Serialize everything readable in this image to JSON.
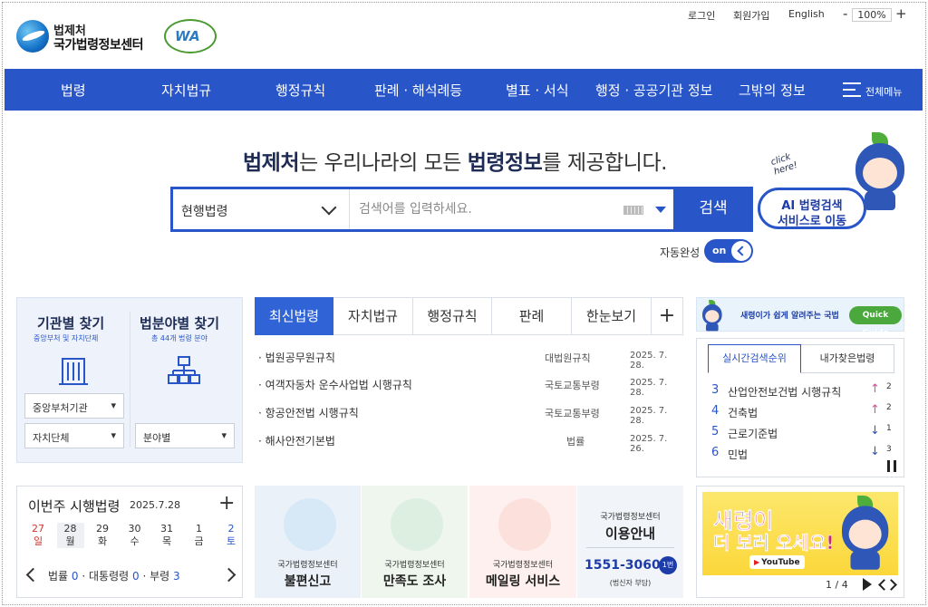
{
  "header": {
    "logo_small": "법제처",
    "logo_big": "국가법령정보센터",
    "wa_mark": "WA",
    "util_links": [
      "로그인",
      "회원가입",
      "English"
    ],
    "zoom": {
      "minus": "-",
      "value": "100%",
      "plus": "+"
    }
  },
  "nav": {
    "items": [
      "법령",
      "자치법규",
      "행정규칙",
      "판례 · 해석례등",
      "별표 · 서식",
      "행정 · 공공기관 정보",
      "그밖의 정보"
    ],
    "all_menu": "전체메뉴"
  },
  "hero": {
    "b1": "법제처",
    "t1": "는 우리나라의 모든 ",
    "b2": "법령정보",
    "t2": "를 제공합니다."
  },
  "search": {
    "scope": "현행법령",
    "placeholder": "검색어를 입력하세요.",
    "button": "검색",
    "autocomplete_label": "자동완성",
    "autocomplete_state": "on"
  },
  "ai_promo": {
    "click": "click\nhere!",
    "line1": "AI 법령검색",
    "line2": "서비스로 이동"
  },
  "find": {
    "org_title": "기관별 찾기",
    "org_sub": "중앙부처 및 자치단체",
    "field_title": "법분야별 찾기",
    "field_sub": "총 44개 법령 분야",
    "sel_central": "중앙부처기관",
    "sel_local": "자치단체",
    "sel_field": "분야별"
  },
  "laws": {
    "tabs": [
      "최신법령",
      "자치법규",
      "행정규칙",
      "판례",
      "한눈보기"
    ],
    "more": "+",
    "items": [
      {
        "name": "· 법원공무원규칙",
        "type": "대법원규칙",
        "date": "2025. 7. 28."
      },
      {
        "name": "· 여객자동차 운수사업법 시행규칙",
        "type": "국토교통부령",
        "date": "2025. 7. 28."
      },
      {
        "name": "· 항공안전법 시행규칙",
        "type": "국토교통부령",
        "date": "2025. 7. 28."
      },
      {
        "name": "· 해사안전기본법",
        "type": "법률",
        "date": "2025. 7. 26."
      }
    ]
  },
  "quick_guide": {
    "text": "새령이가 쉽게 알려주는 국법",
    "button": "Quick Guide"
  },
  "ranking": {
    "tabs": [
      "실시간검색순위",
      "내가찾은법령"
    ],
    "items": [
      {
        "rank": "3",
        "name": "산업안전보건법 시행규칙",
        "dir": "↑",
        "change": "2",
        "color": "#e0479b"
      },
      {
        "rank": "4",
        "name": "건축법",
        "dir": "↑",
        "change": "2",
        "color": "#e0479b"
      },
      {
        "rank": "5",
        "name": "근로기준법",
        "dir": "↓",
        "change": "1",
        "color": "#2855c8"
      },
      {
        "rank": "6",
        "name": "민법",
        "dir": "↓",
        "change": "3",
        "color": "#2855c8"
      }
    ]
  },
  "week": {
    "title": "이번주 시행법령",
    "date": "2025.7.28",
    "plus": "+",
    "days": [
      {
        "num": "27",
        "dow": "일",
        "kind": "sun"
      },
      {
        "num": "28",
        "dow": "월",
        "kind": "today"
      },
      {
        "num": "29",
        "dow": "화",
        "kind": ""
      },
      {
        "num": "30",
        "dow": "수",
        "kind": ""
      },
      {
        "num": "31",
        "dow": "목",
        "kind": ""
      },
      {
        "num": "1",
        "dow": "금",
        "kind": ""
      },
      {
        "num": "2",
        "dow": "토",
        "kind": "sat"
      }
    ],
    "law_label": "법률",
    "law_count": "0",
    "decree_label": "· 대통령령",
    "decree_count": "0",
    "ordinance_label": "· 부령",
    "ordinance_count": "3"
  },
  "cards": [
    {
      "small": "국가법령정보센터",
      "big": "불편신고",
      "bg": "#eaf1f9",
      "circle": "#d7e8f6"
    },
    {
      "small": "국가법령정보센터",
      "big": "만족도 조사",
      "bg": "#eef6ee",
      "circle": "#dcefe0"
    },
    {
      "small": "국가법령정보센터",
      "big": "메일링 서비스",
      "bg": "#fdf0ee",
      "circle": "#fbe0dc"
    }
  ],
  "info": {
    "small": "국가법령정보센터",
    "big": "이용안내",
    "phone": "1551-3060",
    "badge": "1번",
    "note": "(법신자 부담)"
  },
  "banner": {
    "line1": "새령이",
    "line2": "더 보러 오세요!",
    "youtube": "YouTube",
    "page": "1 / 4"
  }
}
